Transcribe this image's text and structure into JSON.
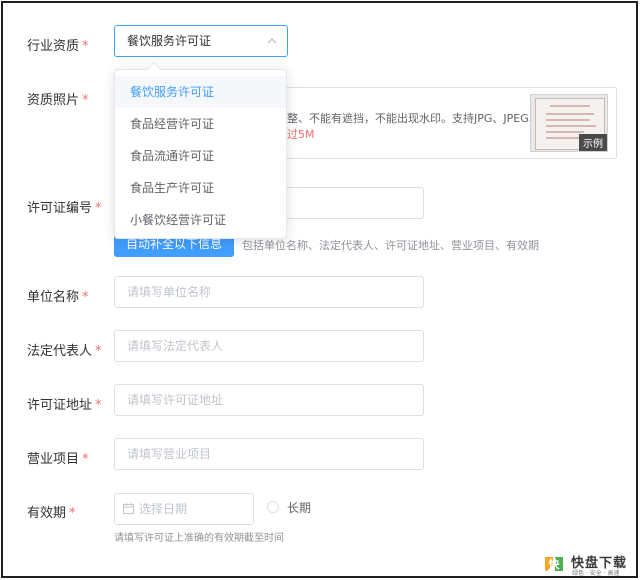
{
  "form": {
    "industry": {
      "label": "行业资质",
      "selected": "餐饮服务许可证",
      "options": [
        "餐饮服务许可证",
        "食品经营许可证",
        "食品流通许可证",
        "食品生产许可证",
        "小餐饮经营许可证"
      ]
    },
    "photo": {
      "label": "资质照片",
      "tip_line1": "整、不能有遮挡，不能出现水印。支持JPG、JPEG、",
      "tip_line2": "过5M",
      "sample_tag": "示例"
    },
    "license_no": {
      "label": "许可证编号",
      "autofill_button": "自动补全以下信息",
      "autofill_hint": "包括单位名称、法定代表人、许可证地址、营业项目、有效期"
    },
    "unit_name": {
      "label": "单位名称",
      "placeholder": "请填写单位名称"
    },
    "legal_rep": {
      "label": "法定代表人",
      "placeholder": "请填写法定代表人"
    },
    "address": {
      "label": "许可证地址",
      "placeholder": "请填写许可证地址"
    },
    "business": {
      "label": "营业项目",
      "placeholder": "请填写营业项目"
    },
    "validity": {
      "label": "有效期",
      "date_placeholder": "选择日期",
      "long_term": "长期",
      "note": "请填写许可证上准确的有效期截至时间"
    },
    "required_mark": "*"
  },
  "watermark": {
    "name": "快盘下载",
    "glyph": "快",
    "slogan": "绿色 · 安全 · 高速"
  },
  "colors": {
    "primary": "#409eff",
    "required": "#f56c6c",
    "border": "#dcdfe6"
  }
}
